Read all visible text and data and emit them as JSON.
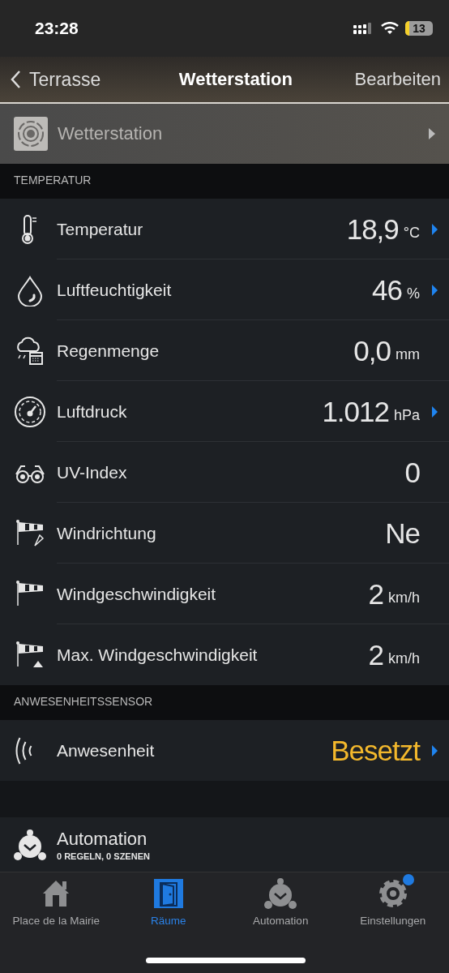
{
  "status_bar": {
    "time": "23:28",
    "battery": "13"
  },
  "nav": {
    "back": "Terrasse",
    "title": "Wetterstation",
    "action": "Bearbeiten"
  },
  "device": {
    "name": "Wetterstation"
  },
  "sections": [
    {
      "header": "TEMPERATUR",
      "rows": [
        {
          "kind": "thermometer",
          "label": "Temperatur",
          "value": "18,9",
          "unit": "°C",
          "chevron": true
        },
        {
          "kind": "drop",
          "label": "Luftfeuchtigkeit",
          "value": "46",
          "unit": "%",
          "chevron": true
        },
        {
          "kind": "rain",
          "label": "Regenmenge",
          "value": "0,0",
          "unit": "mm",
          "chevron": false
        },
        {
          "kind": "gauge",
          "label": "Luftdruck",
          "value": "1.012",
          "unit": "hPa",
          "chevron": true
        },
        {
          "kind": "glasses",
          "label": "UV-Index",
          "value": "0",
          "chevron": false
        },
        {
          "kind": "windsock-compass",
          "label": "Windrichtung",
          "value": "Ne",
          "chevron": false
        },
        {
          "kind": "windsock",
          "label": "Windgeschwindigkeit",
          "value": "2",
          "unit": "km/h",
          "chevron": false
        },
        {
          "kind": "windsock-max",
          "label": "Max. Windgeschwindigkeit",
          "value": "2",
          "unit": "km/h",
          "chevron": false
        }
      ]
    },
    {
      "header": "ANWESENHEITSSENSOR",
      "rows": [
        {
          "kind": "presence",
          "label": "Anwesenheit",
          "value": "Besetzt",
          "color": "#f3b82c",
          "chevron": true
        }
      ]
    }
  ],
  "automation": {
    "title": "Automation",
    "subtitle": "0 REGELN, 0 SZENEN"
  },
  "tabs": [
    {
      "kind": "house",
      "label": "Place de la Mairie",
      "selected": false,
      "badge": false
    },
    {
      "kind": "door",
      "label": "Räume",
      "selected": true,
      "badge": false
    },
    {
      "kind": "alarm",
      "label": "Automation",
      "selected": false,
      "badge": false
    },
    {
      "kind": "gear",
      "label": "Einstellungen",
      "selected": false,
      "badge": true
    }
  ]
}
